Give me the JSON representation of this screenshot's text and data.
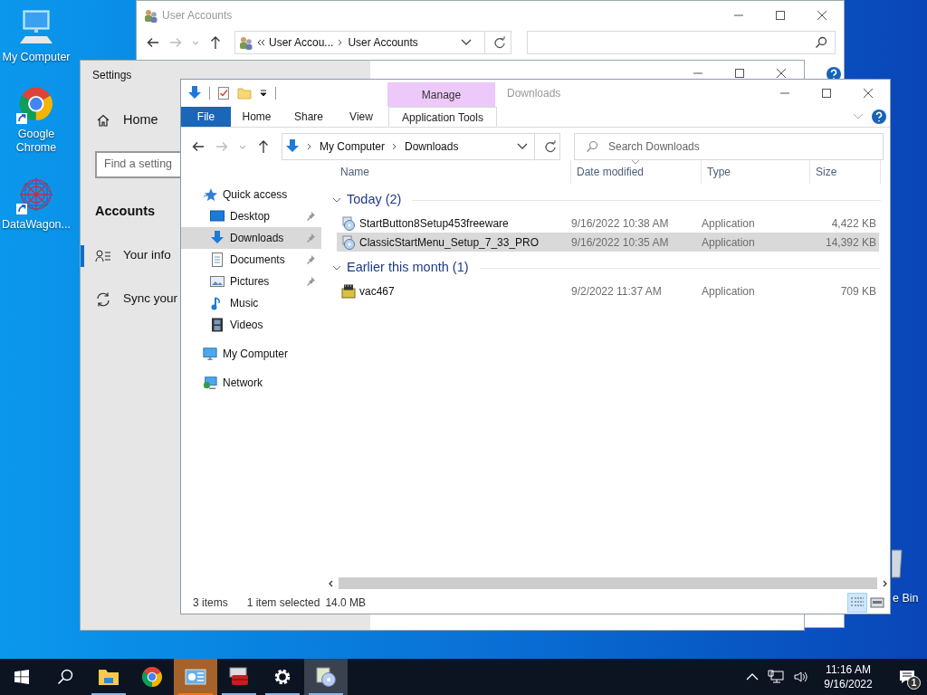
{
  "desktop": {
    "icons": [
      {
        "kind": "computer",
        "label": "My Computer",
        "shortcut": false
      },
      {
        "kind": "chrome",
        "label": "Google Chrome",
        "shortcut": true
      },
      {
        "kind": "datawagon",
        "label": "DataWagon...",
        "shortcut": true
      }
    ],
    "recycle_bin": {
      "label": "e Bin"
    }
  },
  "user_accounts_window": {
    "title": "User Accounts",
    "breadcrumb": [
      "User Accou...",
      "User Accounts"
    ]
  },
  "settings_window": {
    "title": "Settings",
    "home": "Home",
    "search": {
      "placeholder": "Find a setting"
    },
    "section": "Accounts",
    "nav": [
      {
        "kind": "info",
        "label": "Your info",
        "selected": true
      },
      {
        "kind": "sync",
        "label": "Sync your",
        "selected": false
      }
    ]
  },
  "explorer": {
    "title": "Downloads",
    "context_tab": {
      "group": "Manage",
      "label": "Application Tools"
    },
    "ribbon_tabs": [
      {
        "kind": "file",
        "label": "File"
      },
      {
        "kind": "tab",
        "label": "Home"
      },
      {
        "kind": "tab",
        "label": "Share"
      },
      {
        "kind": "tab",
        "label": "View"
      }
    ],
    "address": [
      "My Computer",
      "Downloads"
    ],
    "search": {
      "placeholder": "Search Downloads"
    },
    "nav": [
      {
        "kind": "quick",
        "label": "Quick access",
        "selected": false,
        "children": [
          {
            "kind": "desktop",
            "label": "Desktop",
            "pinned": true,
            "selected": false
          },
          {
            "kind": "downloads",
            "label": "Downloads",
            "pinned": true,
            "selected": true
          },
          {
            "kind": "documents",
            "label": "Documents",
            "pinned": true,
            "selected": false
          },
          {
            "kind": "pictures",
            "label": "Pictures",
            "pinned": true,
            "selected": false
          },
          {
            "kind": "music",
            "label": "Music",
            "pinned": false,
            "selected": false
          },
          {
            "kind": "videos",
            "label": "Videos",
            "pinned": false,
            "selected": false
          }
        ]
      },
      {
        "kind": "computer",
        "label": "My Computer",
        "selected": false
      },
      {
        "kind": "network",
        "label": "Network",
        "selected": false
      }
    ],
    "columns": [
      {
        "label": "Name",
        "sorted": false
      },
      {
        "label": "Date modified",
        "sorted": true
      },
      {
        "label": "Type",
        "sorted": false
      },
      {
        "label": "Size",
        "sorted": false
      }
    ],
    "groups": [
      {
        "label": "Today (2)",
        "expanded": true,
        "files": [
          {
            "kind": "setup",
            "name": "StartButton8Setup453freeware",
            "date": "9/16/2022 10:38 AM",
            "type": "Application",
            "size": "4,422 KB",
            "selected": false
          },
          {
            "kind": "setup",
            "name": "ClassicStartMenu_Setup_7_33_PRO",
            "date": "9/16/2022 10:35 AM",
            "type": "Application",
            "size": "14,392 KB",
            "selected": true
          }
        ]
      },
      {
        "label": "Earlier this month (1)",
        "expanded": true,
        "files": [
          {
            "kind": "archive",
            "name": "vac467",
            "date": "9/2/2022 11:37 AM",
            "type": "Application",
            "size": "709 KB",
            "selected": false
          }
        ]
      }
    ],
    "status": {
      "count": "3 items",
      "selection": "1 item selected",
      "size": "14.0 MB"
    },
    "views": [
      {
        "kind": "details",
        "selected": true
      },
      {
        "kind": "tiles",
        "selected": false
      }
    ]
  },
  "taskbar": {
    "apps": [
      {
        "kind": "start",
        "running": false,
        "flashing": false,
        "hovered": false
      },
      {
        "kind": "search",
        "running": false,
        "flashing": false,
        "hovered": false
      },
      {
        "kind": "explorer",
        "running": true,
        "flashing": false,
        "hovered": false
      },
      {
        "kind": "chrome",
        "running": false,
        "flashing": false,
        "hovered": false
      },
      {
        "kind": "control-panel",
        "running": true,
        "flashing": true,
        "hovered": false
      },
      {
        "kind": "toolbox",
        "running": true,
        "flashing": false,
        "hovered": false
      },
      {
        "kind": "settings",
        "running": true,
        "flashing": false,
        "hovered": false
      },
      {
        "kind": "setup",
        "running": true,
        "flashing": false,
        "hovered": true
      }
    ],
    "tray": {
      "time": "11:16 AM",
      "date": "9/16/2022",
      "notifications": "1"
    }
  }
}
